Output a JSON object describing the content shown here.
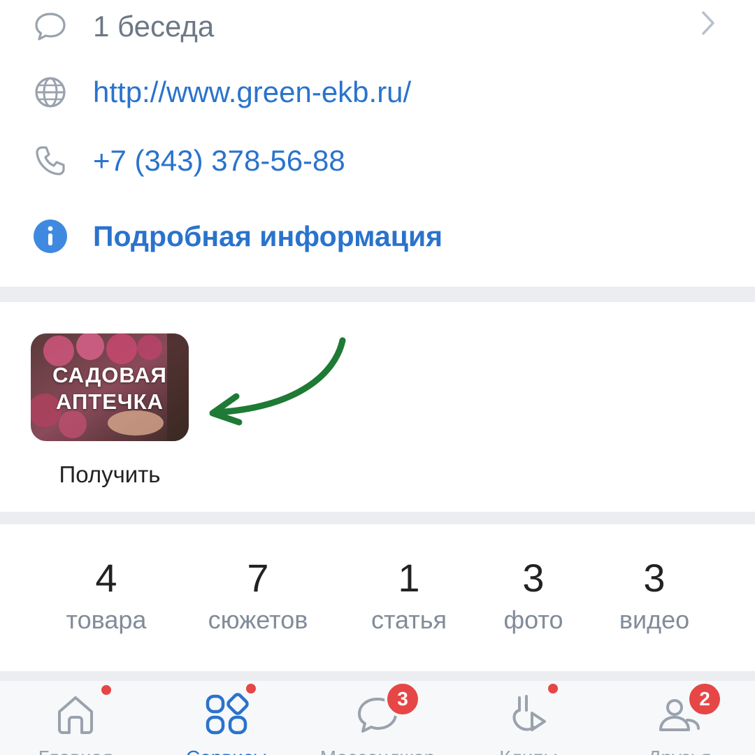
{
  "info": {
    "chat_label": "1 беседа",
    "website": "http://www.green-ekb.ru/",
    "phone": "+7 (343) 378-56-88",
    "more_info": "Подробная информация"
  },
  "app": {
    "title_line1": "САДОВАЯ",
    "title_line2": "АПТЕЧКА",
    "caption": "Получить",
    "arrow_color": "#1e7a34"
  },
  "stats": [
    {
      "value": "4",
      "label": "товара"
    },
    {
      "value": "7",
      "label": "сюжетов"
    },
    {
      "value": "1",
      "label": "статья"
    },
    {
      "value": "3",
      "label": "фото"
    },
    {
      "value": "3",
      "label": "видео"
    }
  ],
  "tabbar": {
    "tabs": [
      {
        "label": "Главная",
        "icon": "home-icon",
        "dot": true
      },
      {
        "label": "Сервисы",
        "icon": "services-icon",
        "dot": true,
        "active": true
      },
      {
        "label": "Мессенджер",
        "icon": "messenger-icon",
        "badge": "3"
      },
      {
        "label": "Клипы",
        "icon": "clips-icon",
        "dot": true
      },
      {
        "label": "Друзья",
        "icon": "friends-icon",
        "badge": "2"
      }
    ]
  },
  "colors": {
    "link": "#2a73cc",
    "badge": "#e64646",
    "separator": "#ebedf0",
    "icon_gray": "#99a2ad"
  }
}
